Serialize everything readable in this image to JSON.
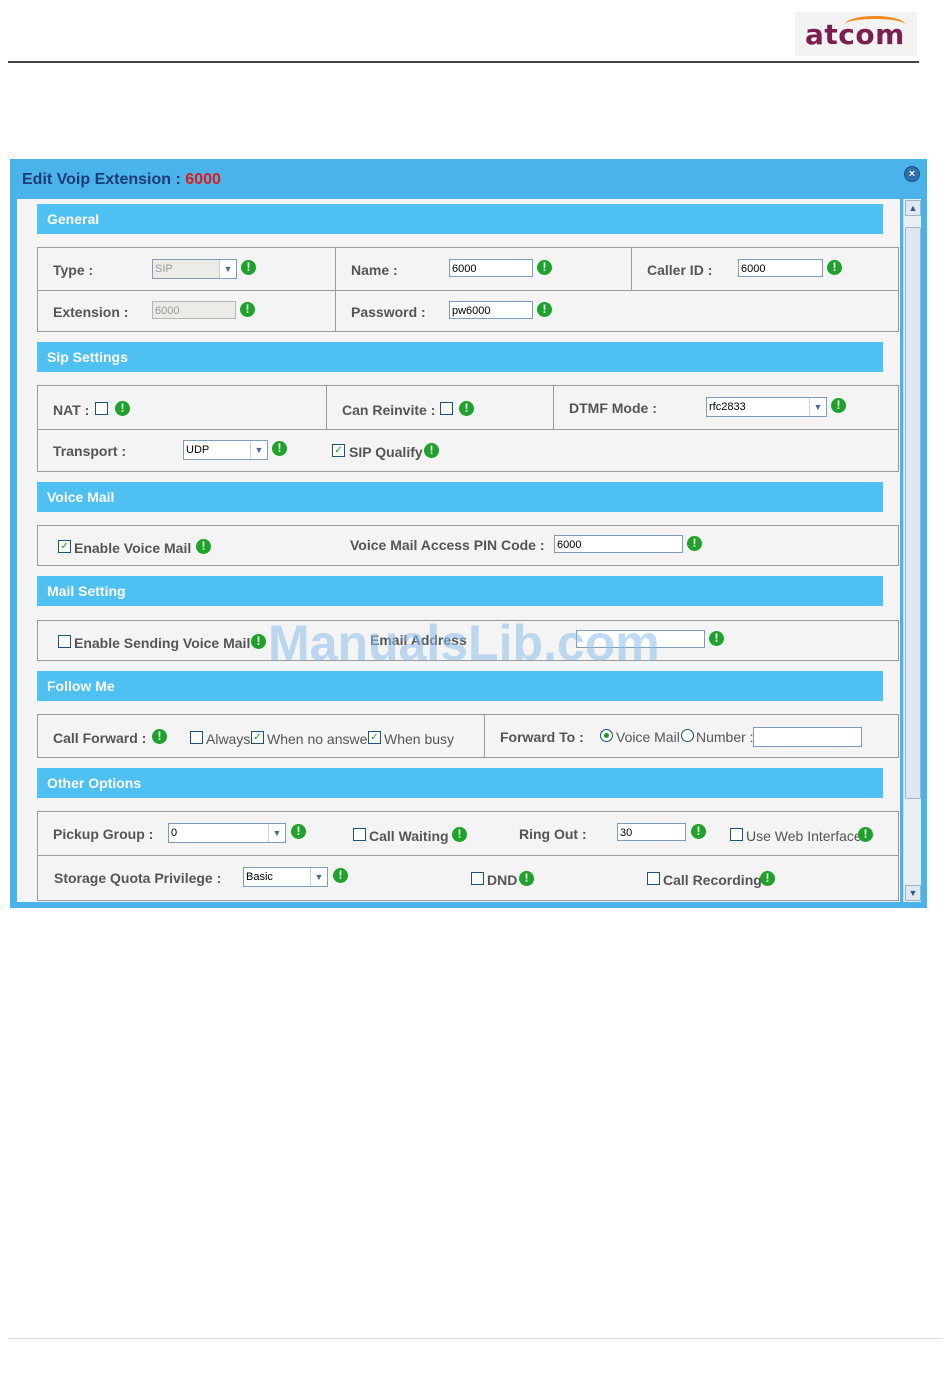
{
  "brand": {
    "logo_text": "atcom"
  },
  "dialog": {
    "title_prefix": "Edit Voip Extension : ",
    "title_ext": "6000",
    "close_icon": "close-icon"
  },
  "general": {
    "section_title": "General",
    "type_label": "Type :",
    "type_value": "SIP",
    "name_label": "Name :",
    "name_value": "6000",
    "callerid_label": "Caller ID :",
    "callerid_value": "6000",
    "extension_label": "Extension :",
    "extension_value": "6000",
    "password_label": "Password :",
    "password_value": "pw6000"
  },
  "sip": {
    "section_title": "Sip Settings",
    "nat_label": "NAT :",
    "nat_checked": false,
    "reinvite_label": "Can Reinvite :",
    "reinvite_checked": false,
    "dtmf_label": "DTMF Mode :",
    "dtmf_value": "rfc2833",
    "transport_label": "Transport :",
    "transport_value": "UDP",
    "qualify_label": "SIP Qualify",
    "qualify_checked": true
  },
  "voicemail": {
    "section_title": "Voice Mail",
    "enable_label": "Enable Voice Mail",
    "enable_checked": true,
    "pin_label": "Voice Mail Access PIN Code :",
    "pin_value": "6000"
  },
  "mail": {
    "section_title": "Mail Setting",
    "enable_label": "Enable Sending Voice Mail",
    "enable_checked": false,
    "email_label": "Email Address",
    "email_value": ""
  },
  "follow": {
    "section_title": "Follow Me",
    "forward_label": "Call Forward :",
    "always_label": "Always",
    "always_checked": false,
    "noanswer_label": "When no answer",
    "noanswer_checked": true,
    "busy_label": "When busy",
    "busy_checked": true,
    "forward_to_label": "Forward To :",
    "voicemail_label": "Voice Mail",
    "number_label": "Number :",
    "number_value": ""
  },
  "other": {
    "section_title": "Other Options",
    "pickup_label": "Pickup Group :",
    "pickup_value": "0",
    "callwaiting_label": "Call Waiting",
    "ringout_label": "Ring Out :",
    "ringout_value": "30",
    "webif_label": "Use Web Interface",
    "quota_label": "Storage Quota Privilege :",
    "quota_value": "Basic",
    "dnd_label": "DND",
    "recording_label": "Call Recording"
  },
  "watermark": "ManualsLib.com",
  "colors": {
    "section": "#4ec0f2",
    "dialog": "#4ab3ea",
    "info": "#1fa22b",
    "title": "#1d3b78",
    "ext": "#e01919"
  }
}
